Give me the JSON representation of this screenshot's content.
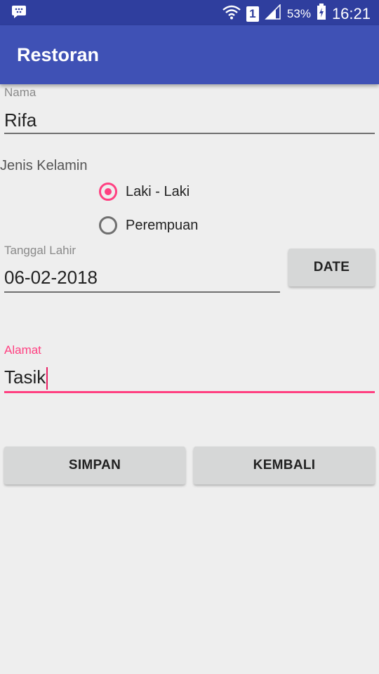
{
  "status_bar": {
    "signal_badge": "1",
    "battery": "53%",
    "time": "16:21"
  },
  "app_bar": {
    "title": "Restoran"
  },
  "form": {
    "nama": {
      "label": "Nama",
      "value": "Rifa"
    },
    "jenis_kelamin": {
      "label": "Jenis Kelamin",
      "options": [
        {
          "label": "Laki - Laki",
          "selected": true
        },
        {
          "label": "Perempuan",
          "selected": false
        }
      ]
    },
    "tanggal_lahir": {
      "label": "Tanggal Lahir",
      "value": "06-02-2018"
    },
    "date_button": "DATE",
    "alamat": {
      "label": "Alamat",
      "value": "Tasik"
    },
    "buttons": {
      "simpan": "SIMPAN",
      "kembali": "KEMBALI"
    }
  },
  "colors": {
    "status_bar": "#2f3e9e",
    "app_bar": "#3f51b5",
    "accent": "#ff4081",
    "background": "#eeeeee"
  }
}
